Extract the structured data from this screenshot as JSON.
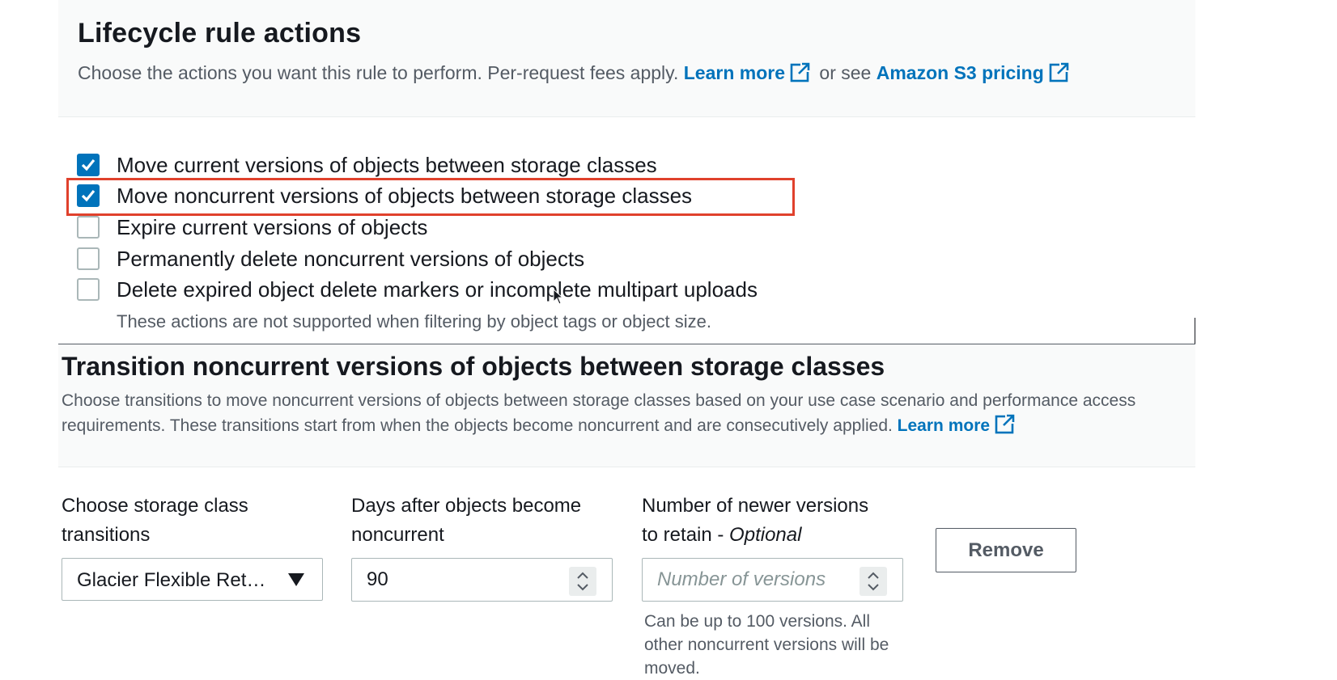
{
  "actions": {
    "title": "Lifecycle rule actions",
    "desc_prefix": "Choose the actions you want this rule to perform. Per-request fees apply.",
    "learn_more": "Learn more",
    "or_see": "or see",
    "pricing_link": "Amazon S3 pricing",
    "options": [
      {
        "label": "Move current versions of objects between storage classes",
        "checked": true
      },
      {
        "label": "Move noncurrent versions of objects between storage classes",
        "checked": true
      },
      {
        "label": "Expire current versions of objects",
        "checked": false
      },
      {
        "label": "Permanently delete noncurrent versions of objects",
        "checked": false
      },
      {
        "label": "Delete expired object delete markers or incomplete multipart uploads",
        "checked": false
      }
    ],
    "hint": "These actions are not supported when filtering by object tags or object size."
  },
  "transition": {
    "title": "Transition noncurrent versions of objects between storage classes",
    "desc": "Choose transitions to move noncurrent versions of objects between storage classes based on your use case scenario and performance access requirements. These transitions start from when the objects become noncurrent and are consecutively applied.",
    "learn_more": "Learn more",
    "storage_label_line1": "Choose storage class",
    "storage_label_line2": "transitions",
    "storage_value": "Glacier Flexible Ret…",
    "days_label_line1": "Days after objects become",
    "days_label_line2": "noncurrent",
    "days_value": "90",
    "versions_label_line1": "Number of newer versions",
    "versions_label_line2": "to retain - ",
    "versions_label_optional": "Optional",
    "versions_placeholder": "Number of versions",
    "versions_help": "Can be up to 100 versions. All other noncurrent versions will be moved.",
    "remove_label": "Remove"
  },
  "colors": {
    "link": "#0073bb",
    "checkbox_checked": "#0073bb",
    "highlight_border": "#e0412c",
    "section_bg": "#f9fafa"
  }
}
